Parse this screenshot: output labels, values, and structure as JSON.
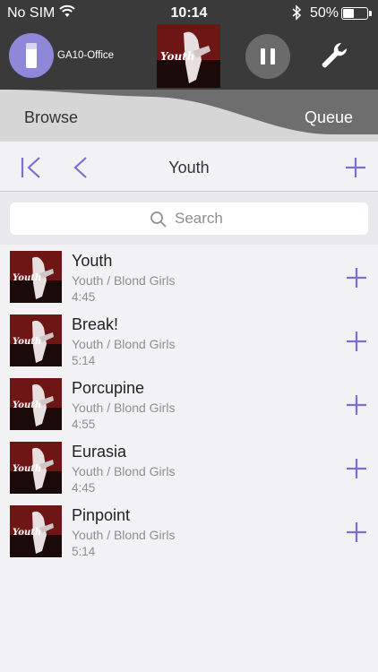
{
  "status_bar": {
    "carrier": "No SIM",
    "time": "10:14",
    "battery": "50%",
    "battery_level": 0.5
  },
  "player": {
    "device_name": "GA10-Office",
    "album_art_text": "Youth",
    "pause_icon": "pause-icon",
    "settings_icon": "wrench-icon"
  },
  "tabs": {
    "browse": "Browse",
    "queue": "Queue"
  },
  "navbar": {
    "title": "Youth"
  },
  "search": {
    "placeholder": "Search"
  },
  "tracks": [
    {
      "title": "Youth",
      "subtitle": "Youth / Blond Girls",
      "duration": "4:45"
    },
    {
      "title": "Break!",
      "subtitle": "Youth / Blond Girls",
      "duration": "5:14"
    },
    {
      "title": "Porcupine",
      "subtitle": "Youth / Blond Girls",
      "duration": "4:55"
    },
    {
      "title": "Eurasia",
      "subtitle": "Youth / Blond Girls",
      "duration": "4:45"
    },
    {
      "title": "Pinpoint",
      "subtitle": "Youth / Blond Girls",
      "duration": "5:14"
    }
  ],
  "colors": {
    "accent": "#7b6fd0",
    "header_bg": "#3a3a3a",
    "tab_dark": "#6e6e6e",
    "tab_light": "#d6d6d6"
  }
}
